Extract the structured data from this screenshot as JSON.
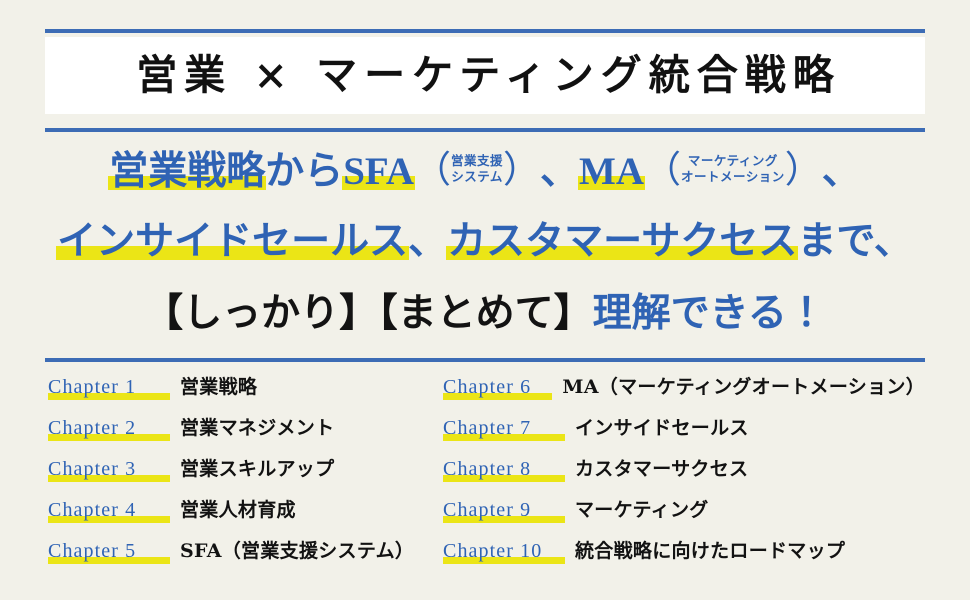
{
  "theme": {
    "background": "#f2f1e9",
    "rule_color": "#3d6cb5",
    "accent_blue": "#2f63b4",
    "highlight_yellow": "#ebe516",
    "text_black": "#131313",
    "band_white": "#ffffff"
  },
  "header": {
    "title": "営業 × マーケティング統合戦略"
  },
  "subtitle": {
    "line1": {
      "seg1": "営業戦略",
      "seg2": "から",
      "seg3": "SFA",
      "paren_open": "（",
      "ruby1_top": "営業支援",
      "ruby1_bottom": "システム",
      "paren_close": "）",
      "seg4": "、",
      "seg5": "MA",
      "ruby2_top": "マーケティング",
      "ruby2_bottom": "オートメーション",
      "seg6": "、"
    },
    "line2": {
      "seg1": "インサイドセールス",
      "seg2": "、",
      "seg3": "カスタマーサクセス",
      "seg4": "まで、"
    },
    "line3": {
      "seg1": "【しっかり】【まとめて】",
      "seg2": "理解できる！"
    }
  },
  "chapters": {
    "left": [
      {
        "label": "Chapter 1",
        "title": "営業戦略"
      },
      {
        "label": "Chapter 2",
        "title": "営業マネジメント"
      },
      {
        "label": "Chapter 3",
        "title": "営業スキルアップ"
      },
      {
        "label": "Chapter 4",
        "title": "営業人材育成"
      },
      {
        "label": "Chapter 5",
        "title": "SFA（営業支援システム）"
      }
    ],
    "right": [
      {
        "label": "Chapter 6",
        "title": "MA（マーケティングオートメーション）"
      },
      {
        "label": "Chapter 7",
        "title": "インサイドセールス"
      },
      {
        "label": "Chapter 8",
        "title": "カスタマーサクセス"
      },
      {
        "label": "Chapter 9",
        "title": "マーケティング"
      },
      {
        "label": "Chapter 10",
        "title": "統合戦略に向けたロードマップ"
      }
    ]
  }
}
